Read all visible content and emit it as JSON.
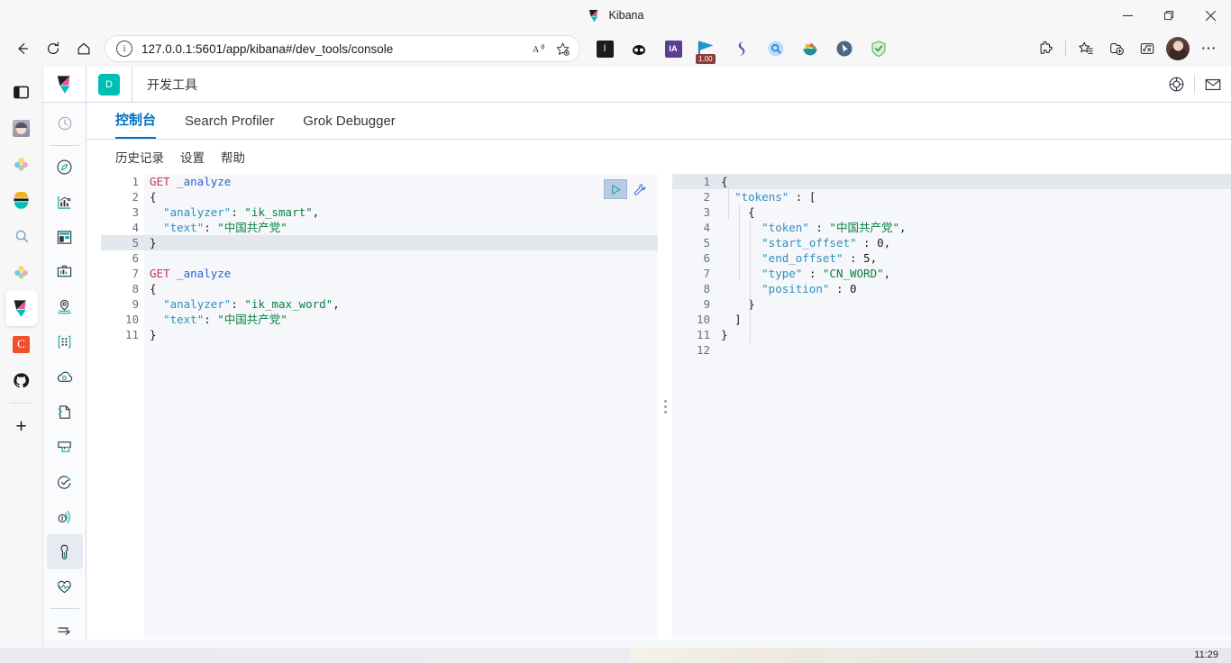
{
  "window": {
    "tab_title": "Kibana",
    "minimize_label": "—",
    "restore_label": "❐",
    "close_label": "✕"
  },
  "browser": {
    "back_label": "←",
    "refresh_label": "↻",
    "home_label": "⌂",
    "url": "127.0.0.1:5601/app/kibana#/dev_tools/console",
    "read_aloud_label": "A",
    "favorite_label": "☆",
    "extensions": [
      {
        "name": "extension-lastpass",
        "label": "L"
      },
      {
        "name": "extension-adblock",
        "label": ""
      },
      {
        "name": "extension-ia-writer",
        "label": "IA"
      },
      {
        "name": "extension-flag-badge",
        "label": "1.00"
      },
      {
        "name": "extension-similarweb",
        "label": ""
      },
      {
        "name": "extension-search-bubble",
        "label": ""
      },
      {
        "name": "extension-fruit-bowl",
        "label": ""
      },
      {
        "name": "extension-cursor",
        "label": ""
      },
      {
        "name": "extension-adguard",
        "label": ""
      }
    ],
    "toolbar_right": [
      {
        "name": "extensions-puzzle-icon"
      },
      {
        "name": "collections-icon"
      },
      {
        "name": "add-tab-group-icon"
      },
      {
        "name": "math-solver-icon"
      },
      {
        "name": "profile-avatar"
      },
      {
        "name": "settings-more-icon",
        "label": "⋯"
      }
    ]
  },
  "vertical_tab_rail": {
    "items": [
      {
        "name": "tab-search-panel",
        "label": ""
      },
      {
        "name": "tab-anime-site",
        "label": ""
      },
      {
        "name": "tab-flower-app-1",
        "label": ""
      },
      {
        "name": "tab-elastic",
        "label": ""
      },
      {
        "name": "tab-search",
        "label": ""
      },
      {
        "name": "tab-flower-app-2",
        "label": ""
      },
      {
        "name": "tab-kibana",
        "label": "",
        "active": true
      },
      {
        "name": "tab-c-app",
        "label": "C"
      },
      {
        "name": "tab-github",
        "label": ""
      }
    ],
    "add_tab_label": "+"
  },
  "kibana": {
    "badge_letter": "D",
    "breadcrumb": "开发工具",
    "header_icons": [
      {
        "name": "help-lifebuoy-icon"
      },
      {
        "name": "newsfeed-envelope-icon"
      }
    ],
    "nav_items": [
      {
        "name": "nav-recently-viewed",
        "icon": "clock-icon"
      },
      {
        "name": "nav-discover",
        "icon": "compass-icon"
      },
      {
        "name": "nav-visualize",
        "icon": "chart-icon"
      },
      {
        "name": "nav-dashboard",
        "icon": "dashboard-icon"
      },
      {
        "name": "nav-canvas",
        "icon": "canvas-icon"
      },
      {
        "name": "nav-maps",
        "icon": "map-marker-icon"
      },
      {
        "name": "nav-machine-learning",
        "icon": "ml-nodes-icon"
      },
      {
        "name": "nav-infrastructure",
        "icon": "infra-icon"
      },
      {
        "name": "nav-logs",
        "icon": "logs-icon"
      },
      {
        "name": "nav-apm",
        "icon": "apm-icon"
      },
      {
        "name": "nav-uptime",
        "icon": "uptime-icon"
      },
      {
        "name": "nav-siem",
        "icon": "siem-icon"
      },
      {
        "name": "nav-dev-tools",
        "icon": "wrench-icon",
        "active": true
      },
      {
        "name": "nav-monitoring",
        "icon": "heart-pulse-icon"
      },
      {
        "name": "nav-collapse",
        "icon": "collapse-arrow-icon"
      }
    ],
    "tabs": [
      {
        "name": "tab-console",
        "label": "控制台",
        "active": true
      },
      {
        "name": "tab-search-profiler",
        "label": "Search Profiler",
        "active": false
      },
      {
        "name": "tab-grok-debugger",
        "label": "Grok Debugger",
        "active": false
      }
    ],
    "subtabs": [
      {
        "name": "subtab-history",
        "label": "历史记录"
      },
      {
        "name": "subtab-settings",
        "label": "设置"
      },
      {
        "name": "subtab-help",
        "label": "帮助"
      }
    ],
    "console": {
      "run_button_name": "send-request-play-button",
      "wrench_button_name": "console-options-wrench-button",
      "request_editor": {
        "lines": [
          {
            "n": "1",
            "fold": "",
            "hl": false,
            "tokens": [
              {
                "t": "GET",
                "c": "k-method"
              },
              {
                "t": " ",
                "c": "k-punc"
              },
              {
                "t": "_analyze",
                "c": "k-url"
              }
            ]
          },
          {
            "n": "2",
            "fold": "▾",
            "hl": false,
            "tokens": [
              {
                "t": "{",
                "c": "k-punc"
              }
            ]
          },
          {
            "n": "3",
            "fold": "",
            "hl": false,
            "tokens": [
              {
                "t": "  ",
                "c": "k-punc"
              },
              {
                "t": "\"analyzer\"",
                "c": "k-key"
              },
              {
                "t": ": ",
                "c": "k-punc"
              },
              {
                "t": "\"ik_smart\"",
                "c": "k-str"
              },
              {
                "t": ",",
                "c": "k-punc"
              }
            ]
          },
          {
            "n": "4",
            "fold": "",
            "hl": false,
            "tokens": [
              {
                "t": "  ",
                "c": "k-punc"
              },
              {
                "t": "\"text\"",
                "c": "k-key"
              },
              {
                "t": ": ",
                "c": "k-punc"
              },
              {
                "t": "\"中国共产党\"",
                "c": "k-str"
              }
            ]
          },
          {
            "n": "5",
            "fold": "▴",
            "hl": true,
            "tokens": [
              {
                "t": "}",
                "c": "k-punc"
              }
            ]
          },
          {
            "n": "6",
            "fold": "",
            "hl": false,
            "tokens": []
          },
          {
            "n": "7",
            "fold": "",
            "hl": false,
            "tokens": [
              {
                "t": "GET",
                "c": "k-method"
              },
              {
                "t": " ",
                "c": "k-punc"
              },
              {
                "t": "_analyze",
                "c": "k-url"
              }
            ]
          },
          {
            "n": "8",
            "fold": "▾",
            "hl": false,
            "tokens": [
              {
                "t": "{",
                "c": "k-punc"
              }
            ]
          },
          {
            "n": "9",
            "fold": "",
            "hl": false,
            "tokens": [
              {
                "t": "  ",
                "c": "k-punc"
              },
              {
                "t": "\"analyzer\"",
                "c": "k-key"
              },
              {
                "t": ": ",
                "c": "k-punc"
              },
              {
                "t": "\"ik_max_word\"",
                "c": "k-str"
              },
              {
                "t": ",",
                "c": "k-punc"
              }
            ]
          },
          {
            "n": "10",
            "fold": "",
            "hl": false,
            "tokens": [
              {
                "t": "  ",
                "c": "k-punc"
              },
              {
                "t": "\"text\"",
                "c": "k-key"
              },
              {
                "t": ": ",
                "c": "k-punc"
              },
              {
                "t": "\"中国共产党\"",
                "c": "k-str"
              }
            ]
          },
          {
            "n": "11",
            "fold": "▴",
            "hl": false,
            "tokens": [
              {
                "t": "}",
                "c": "k-punc"
              }
            ]
          }
        ]
      },
      "response_editor": {
        "lines": [
          {
            "n": "1",
            "fold": "▾",
            "hl": true,
            "tokens": [
              {
                "t": "{",
                "c": "k-punc"
              }
            ]
          },
          {
            "n": "2",
            "fold": "▾",
            "hl": false,
            "tokens": [
              {
                "t": "  ",
                "c": "k-punc"
              },
              {
                "t": "\"tokens\"",
                "c": "k-key"
              },
              {
                "t": " : ",
                "c": "k-punc"
              },
              {
                "t": "[",
                "c": "k-punc"
              }
            ]
          },
          {
            "n": "3",
            "fold": "▾",
            "hl": false,
            "tokens": [
              {
                "t": "    ",
                "c": "k-punc"
              },
              {
                "t": "{",
                "c": "k-punc"
              }
            ]
          },
          {
            "n": "4",
            "fold": "",
            "hl": false,
            "tokens": [
              {
                "t": "      ",
                "c": "k-punc"
              },
              {
                "t": "\"token\"",
                "c": "k-key"
              },
              {
                "t": " : ",
                "c": "k-punc"
              },
              {
                "t": "\"中国共产党\"",
                "c": "k-str"
              },
              {
                "t": ",",
                "c": "k-punc"
              }
            ]
          },
          {
            "n": "5",
            "fold": "",
            "hl": false,
            "tokens": [
              {
                "t": "      ",
                "c": "k-punc"
              },
              {
                "t": "\"start_offset\"",
                "c": "k-key"
              },
              {
                "t": " : ",
                "c": "k-punc"
              },
              {
                "t": "0",
                "c": "k-num"
              },
              {
                "t": ",",
                "c": "k-punc"
              }
            ]
          },
          {
            "n": "6",
            "fold": "",
            "hl": false,
            "tokens": [
              {
                "t": "      ",
                "c": "k-punc"
              },
              {
                "t": "\"end_offset\"",
                "c": "k-key"
              },
              {
                "t": " : ",
                "c": "k-punc"
              },
              {
                "t": "5",
                "c": "k-num"
              },
              {
                "t": ",",
                "c": "k-punc"
              }
            ]
          },
          {
            "n": "7",
            "fold": "",
            "hl": false,
            "tokens": [
              {
                "t": "      ",
                "c": "k-punc"
              },
              {
                "t": "\"type\"",
                "c": "k-key"
              },
              {
                "t": " : ",
                "c": "k-punc"
              },
              {
                "t": "\"CN_WORD\"",
                "c": "k-str"
              },
              {
                "t": ",",
                "c": "k-punc"
              }
            ]
          },
          {
            "n": "8",
            "fold": "",
            "hl": false,
            "tokens": [
              {
                "t": "      ",
                "c": "k-punc"
              },
              {
                "t": "\"position\"",
                "c": "k-key"
              },
              {
                "t": " : ",
                "c": "k-punc"
              },
              {
                "t": "0",
                "c": "k-num"
              }
            ]
          },
          {
            "n": "9",
            "fold": "▴",
            "hl": false,
            "tokens": [
              {
                "t": "    ",
                "c": "k-punc"
              },
              {
                "t": "}",
                "c": "k-punc"
              }
            ]
          },
          {
            "n": "10",
            "fold": "▴",
            "hl": false,
            "tokens": [
              {
                "t": "  ",
                "c": "k-punc"
              },
              {
                "t": "]",
                "c": "k-punc"
              }
            ]
          },
          {
            "n": "11",
            "fold": "▴",
            "hl": false,
            "tokens": [
              {
                "t": "}",
                "c": "k-punc"
              }
            ]
          },
          {
            "n": "12",
            "fold": "",
            "hl": false,
            "tokens": []
          }
        ]
      }
    }
  },
  "taskbar": {
    "clock": "11:29"
  }
}
